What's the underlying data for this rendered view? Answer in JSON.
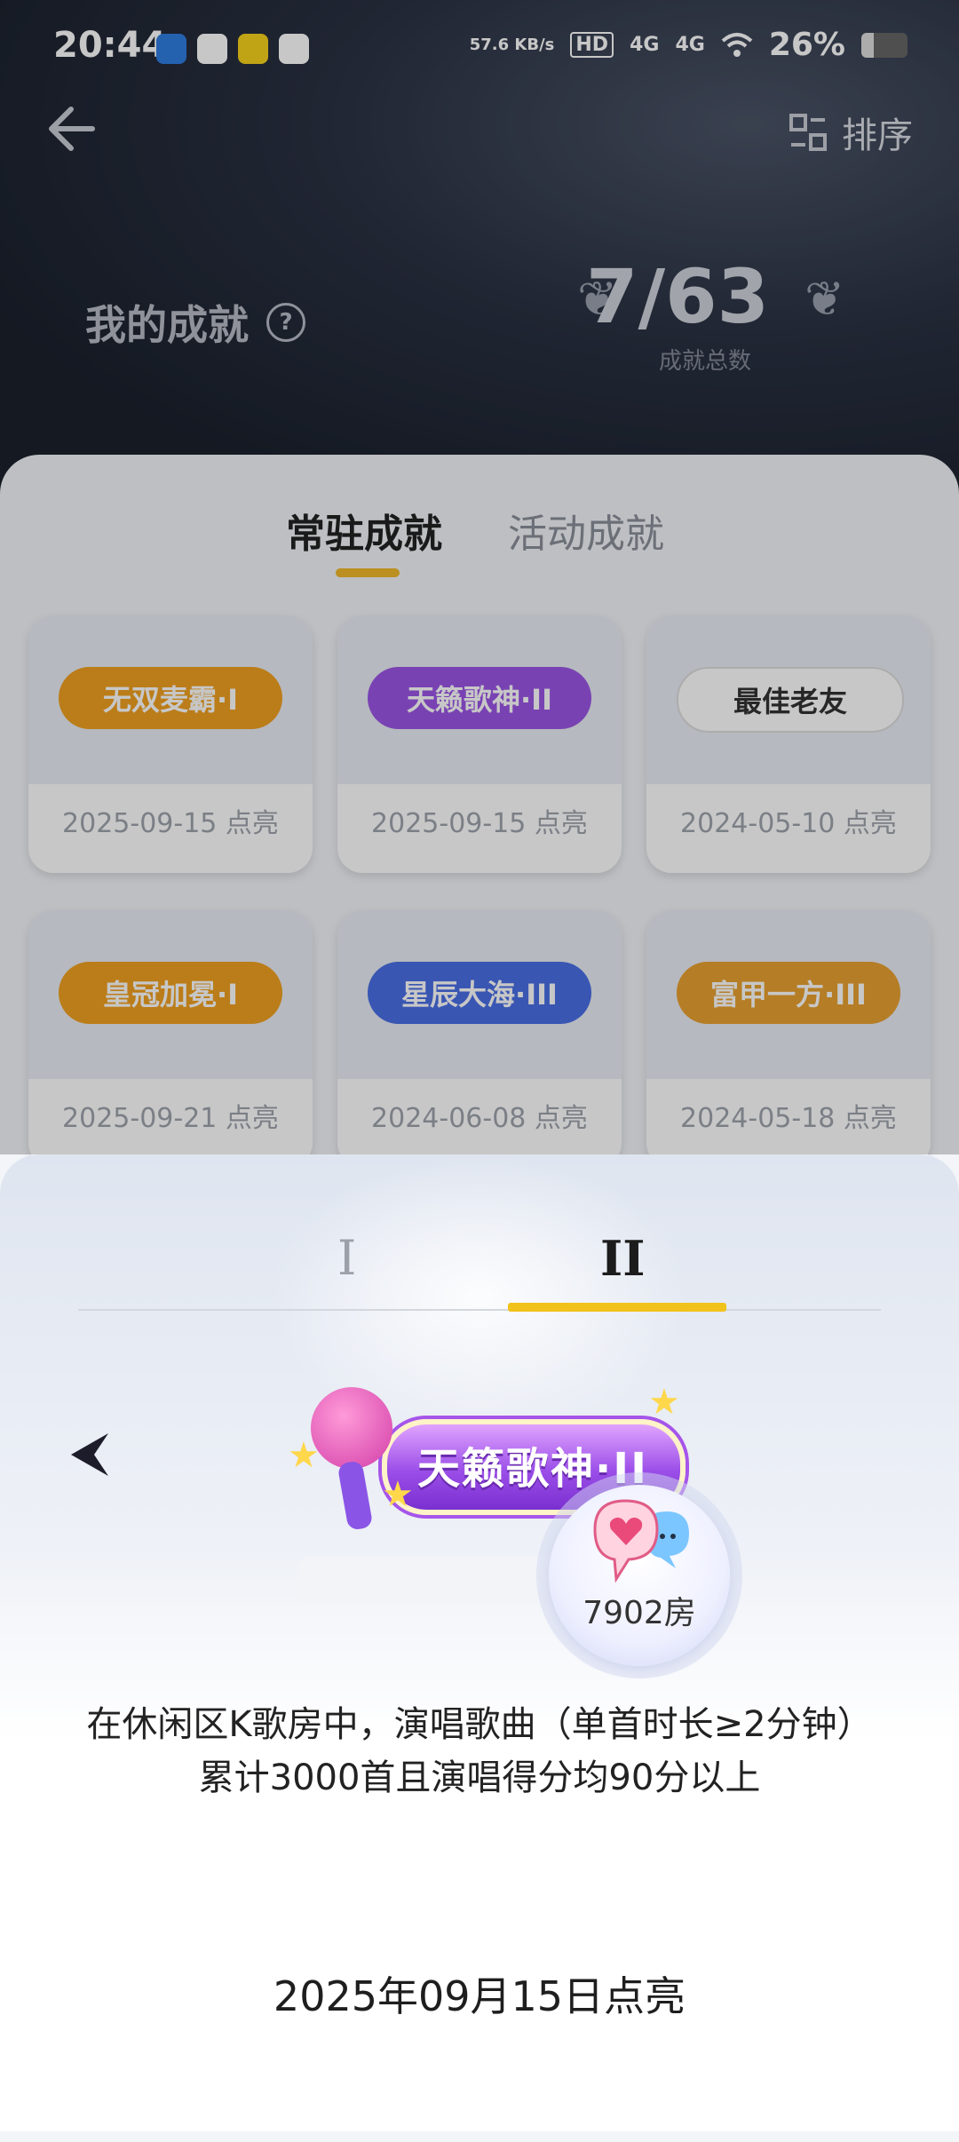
{
  "status_bar": {
    "time": "20:44",
    "net_speed": "57.6\nKB/s",
    "net_speed_text": "57.6 KB/s",
    "signal_labels": [
      "HD",
      "4G",
      "4G"
    ],
    "battery": "26%"
  },
  "header": {
    "sort_label": "排序",
    "my_achievements": "我的成就",
    "help_symbol": "?",
    "count": "7/63",
    "count_label": "成就总数"
  },
  "tabs": {
    "regular": "常驻成就",
    "event": "活动成就"
  },
  "achievements": [
    {
      "name": "无双麦霸·I",
      "date": "2025-09-15 点亮",
      "color": "#f0a020"
    },
    {
      "name": "天籁歌神·II",
      "date": "2025-09-15 点亮",
      "color": "#9b55e6"
    },
    {
      "name": "最佳老友",
      "date": "2024-05-10 点亮",
      "color": "#ffffff"
    },
    {
      "name": "皇冠加冕·I",
      "date": "2025-09-21 点亮",
      "color": "#f0a020"
    },
    {
      "name": "星辰大海·III",
      "date": "2024-06-08 点亮",
      "color": "#4a6fe6"
    },
    {
      "name": "富甲一方·III",
      "date": "2024-05-18 点亮",
      "color": "#e8a030"
    }
  ],
  "sheet": {
    "level_tabs": [
      "I",
      "II"
    ],
    "badge_text": "天籁歌神·II",
    "room_label": "7902房",
    "description": "在休闲区K歌房中，演唱歌曲（单首时长≥2分钟）累计3000首且演唱得分均90分以上",
    "lit_date": "2025年09月15日点亮"
  },
  "colors": {
    "accent": "#f2c21c",
    "header_bg": "#1c2230"
  },
  "icons": [
    "back-arrow-icon",
    "sort-icon",
    "help-icon",
    "laurel-icon",
    "prev-arrow-icon",
    "microphone-icon",
    "chat-heart-icon"
  ]
}
